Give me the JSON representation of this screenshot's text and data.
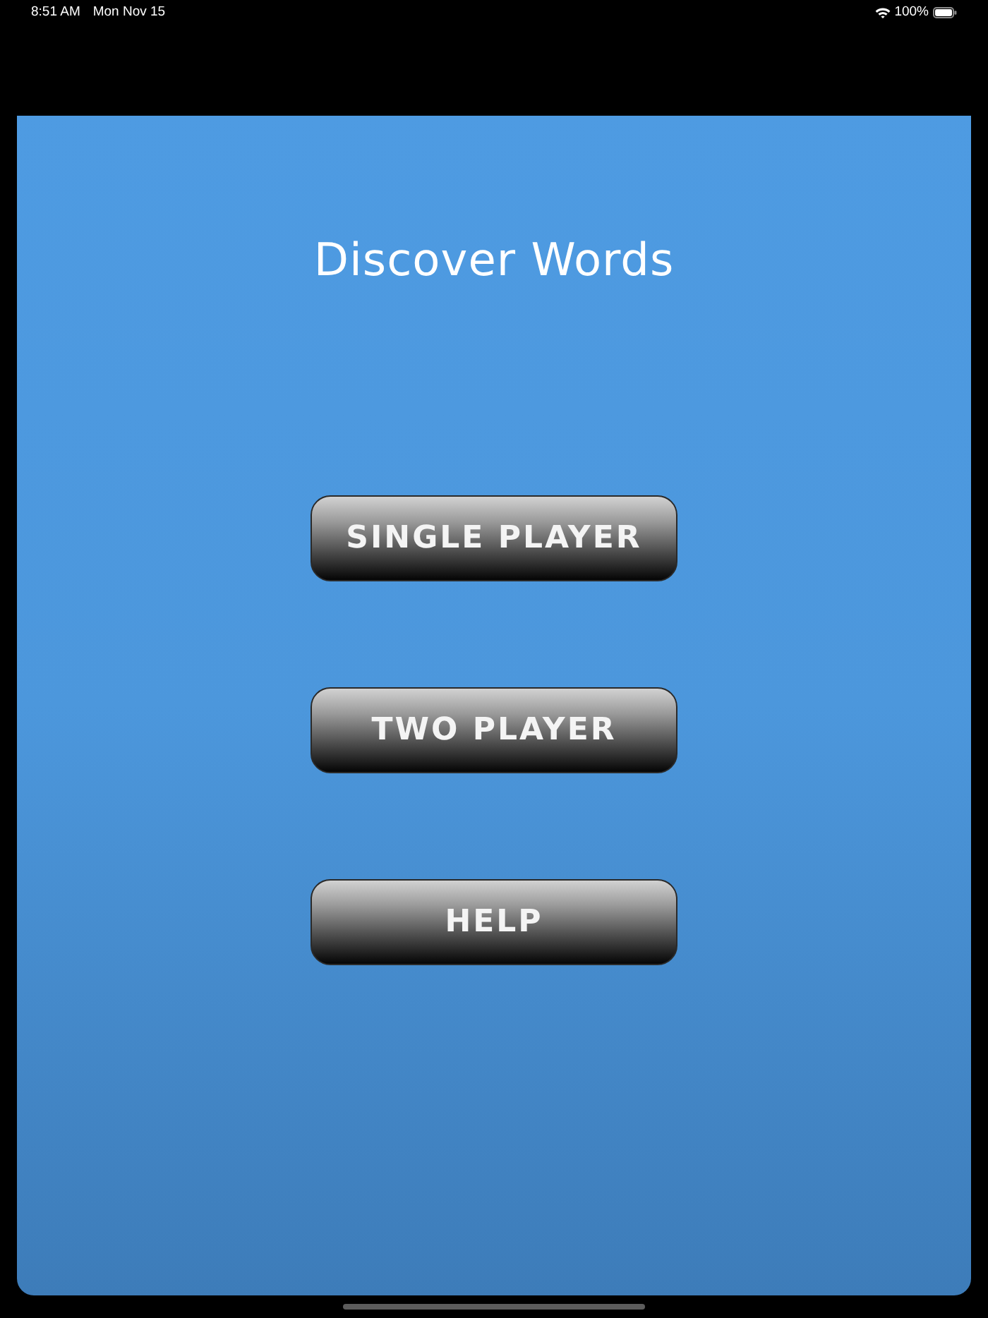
{
  "status_bar": {
    "time": "8:51 AM",
    "date": "Mon Nov 15",
    "battery": "100%"
  },
  "screen": {
    "title": "Discover Words",
    "buttons": [
      {
        "label": "SINGLE PLAYER"
      },
      {
        "label": "TWO PLAYER"
      },
      {
        "label": "HELP"
      }
    ]
  }
}
